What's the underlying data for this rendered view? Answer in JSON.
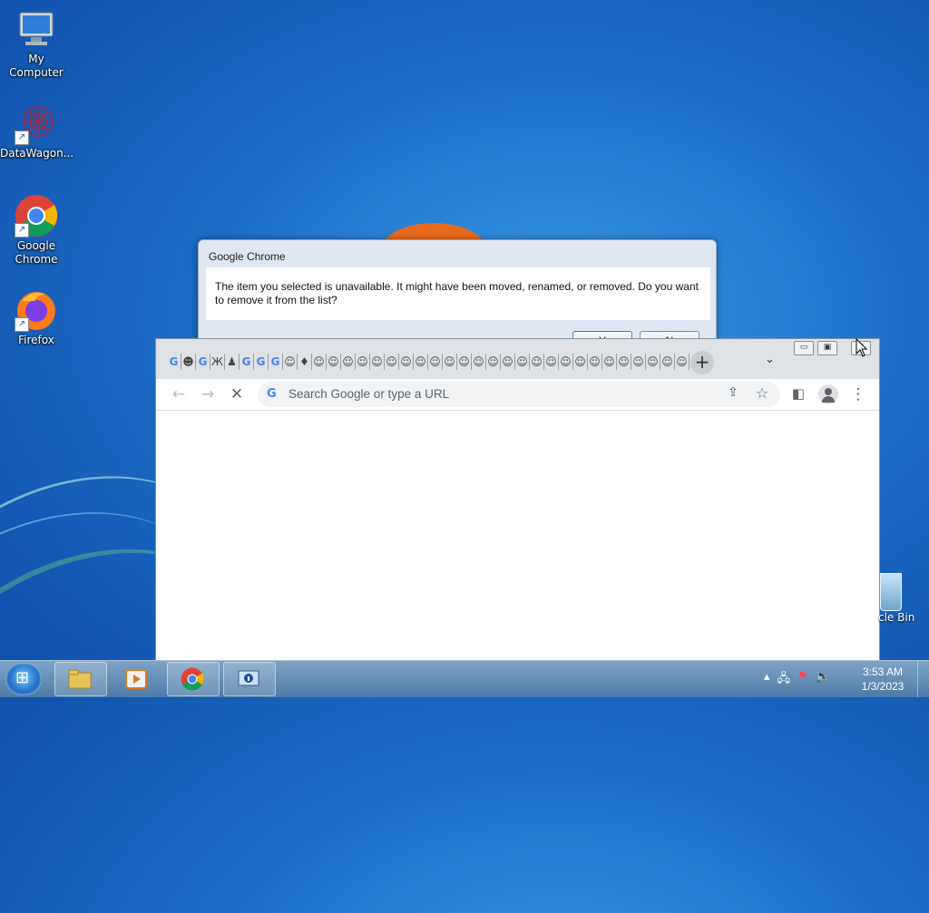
{
  "desktop": {
    "icons": [
      {
        "label": "My Computer"
      },
      {
        "label": "DataWagon..."
      },
      {
        "label": "Google Chrome"
      },
      {
        "label": "Firefox"
      }
    ],
    "recycle_bin_label": "cle Bin"
  },
  "dialog": {
    "title": "Google Chrome",
    "message": "The item you selected is unavailable.  It might have been moved, renamed, or removed.  Do you want to remove it from the list?",
    "yes_label": "Y",
    "no_label": "N"
  },
  "chrome": {
    "tab_favicons": [
      "G",
      "☻",
      "G",
      "Ж",
      "♟",
      "G",
      "G",
      "G",
      "☺",
      "♦",
      "☺",
      "☺",
      "☺",
      "☺",
      "☺",
      "☺",
      "☺",
      "☺",
      "☺",
      "☺",
      "☺",
      "☺",
      "☺",
      "☺",
      "☺",
      "☺",
      "☺",
      "☺",
      "☺",
      "☺",
      "☺",
      "☺",
      "☺",
      "☺",
      "☺",
      "☺",
      "☺"
    ],
    "new_tab_icon": "plus-icon",
    "tab_search_icon": "chevron-down-icon",
    "omnibox": {
      "placeholder": "Search Google or type a URL",
      "value": ""
    }
  },
  "taskbar": {
    "apps": [
      "explorer",
      "media-player",
      "chrome",
      "info-app"
    ],
    "clock_time": "3:53 AM",
    "clock_date": "1/3/2023"
  },
  "colors": {
    "desktop_blue": "#1c6cc6",
    "chrome_tabstrip": "#dee1e6",
    "google_blue": "#4285f4"
  }
}
